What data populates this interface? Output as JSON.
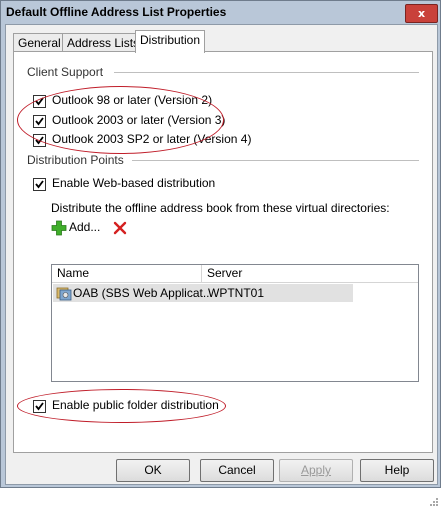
{
  "window": {
    "title": "Default Offline Address List Properties",
    "close_glyph": "x"
  },
  "tabs": [
    {
      "label": "General",
      "active": false
    },
    {
      "label": "Address Lists",
      "active": false
    },
    {
      "label": "Distribution",
      "active": true
    }
  ],
  "client_support": {
    "label": "Client Support",
    "options": [
      {
        "label": "Outlook 98 or later (Version 2)",
        "checked": true
      },
      {
        "label": "Outlook 2003 or later (Version 3)",
        "checked": true
      },
      {
        "label": "Outlook 2003 SP2 or later (Version 4)",
        "checked": true
      }
    ]
  },
  "distribution_points": {
    "label": "Distribution Points",
    "web_based": {
      "label": "Enable Web-based distribution",
      "checked": true
    },
    "vdir_caption": "Distribute the offline address book from these virtual directories:",
    "add_label": "Add...",
    "columns": [
      "Name",
      "Server"
    ],
    "rows": [
      {
        "name": "OAB (SBS Web Applicat...",
        "server": "WPTNT01"
      }
    ],
    "public_folder": {
      "label": "Enable public folder distribution",
      "checked": true
    }
  },
  "buttons": {
    "ok": "OK",
    "cancel": "Cancel",
    "apply": "Apply",
    "help": "Help"
  },
  "colors": {
    "annotation": "#c01e2a",
    "add_icon": "#3fae2a",
    "remove_icon": "#d42020"
  }
}
